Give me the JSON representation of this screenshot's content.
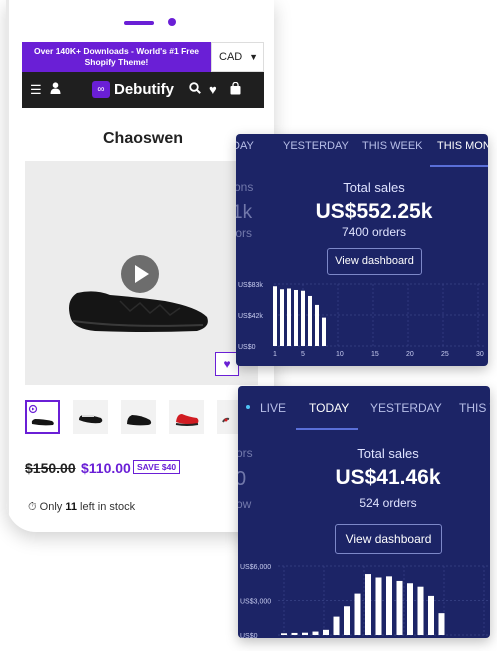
{
  "store": {
    "promo_text": "Over 140K+ Downloads - World's #1 Free Shopify Theme!",
    "currency": "CAD",
    "logo_text": "Debutify",
    "product_title": "Chaoswen",
    "price_old": "$150.00",
    "price_new": "$110.00",
    "save_badge": "SAVE $40",
    "stock_prefix": "Only",
    "stock_count": "11",
    "stock_suffix": "left in stock",
    "icons": [
      "menu-icon",
      "user-icon",
      "search-icon",
      "heart-icon",
      "bag-icon",
      "play-icon"
    ]
  },
  "panel_month": {
    "tabs": [
      "DAY",
      "YESTERDAY",
      "THIS WEEK",
      "THIS MONT"
    ],
    "active_tab": "THIS MONT",
    "ghost_texts": [
      "ons",
      "1k",
      "tors"
    ],
    "total_label": "Total sales",
    "total_value": "US$552.25k",
    "orders": "7400 orders",
    "button": "View dashboard",
    "chart_data": {
      "type": "bar",
      "y_ticks": [
        "US$83k",
        "US$42k",
        "US$0"
      ],
      "ylim": [
        0,
        83
      ],
      "x_ticks": [
        "1",
        "5",
        "10",
        "15",
        "20",
        "25",
        "30"
      ],
      "x": [
        1,
        2,
        3,
        4,
        5,
        6,
        7,
        8
      ],
      "values": [
        80,
        76,
        77,
        75,
        74,
        67,
        55,
        38
      ],
      "grid": true
    }
  },
  "panel_today": {
    "tabs": [
      "LIVE",
      "TODAY",
      "YESTERDAY",
      "THIS W"
    ],
    "active_tab": "TODAY",
    "ghost_texts": [
      "ors",
      "0",
      "ow"
    ],
    "total_label": "Total sales",
    "total_value": "US$41.46k",
    "orders": "524 orders",
    "button": "View dashboard",
    "chart_data": {
      "type": "bar",
      "y_ticks": [
        "US$6,000",
        "US$3,000",
        "US$0"
      ],
      "ylim": [
        0,
        6000
      ],
      "values": [
        150,
        180,
        200,
        300,
        450,
        1600,
        2500,
        3600,
        5300,
        5000,
        5100,
        4700,
        4500,
        4200,
        3400,
        1900
      ],
      "grid": true
    }
  },
  "colors": {
    "brand_purple": "#6a1fd6",
    "navbar_dark": "#1f1f1f",
    "panel_navy": "#1c2466",
    "live_dot": "#4fc3f7"
  }
}
